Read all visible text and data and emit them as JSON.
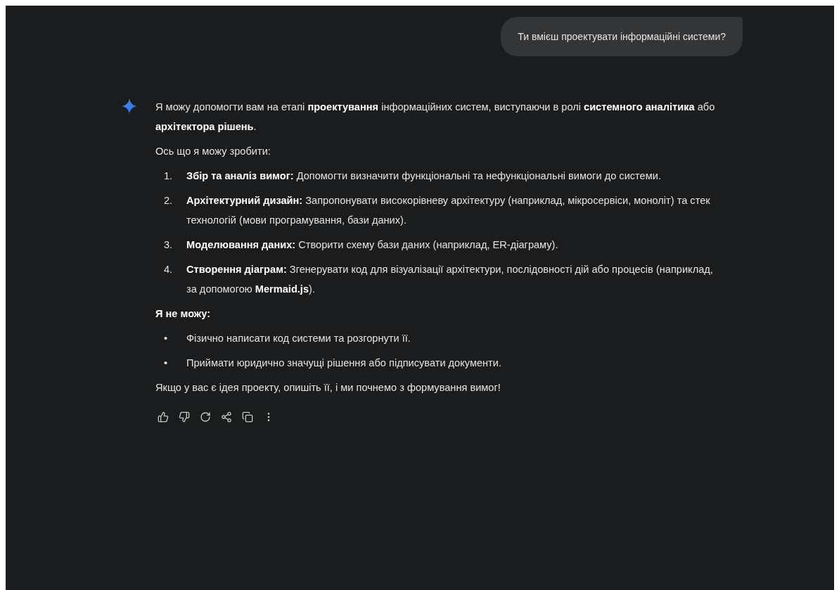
{
  "user_message": {
    "text": "Ти вмієш проектувати інформаційні системи?"
  },
  "response": {
    "intro": "Я можу допомогти вам на етапі **проектування** інформаційних систем, виступаючи в ролі **системного аналітика** або **архітектора рішень**.",
    "lead": "Ось що я можу зробити:",
    "numbered_list": [
      {
        "marker": "1.",
        "text": "**Збір та аналіз вимог:** Допомогти визначити функціональні та нефункціональні вимоги до системи."
      },
      {
        "marker": "2.",
        "text": "**Архітектурний дизайн:** Запропонувати високорівневу архітектуру (наприклад, мікросервіси, моноліт) та стек технологій (мови програмування, бази даних)."
      },
      {
        "marker": "3.",
        "text": "**Моделювання даних:** Створити схему бази даних (наприклад, ER-діаграму)."
      },
      {
        "marker": "4.",
        "text": "**Створення діаграм:** Згенерувати код для візуалізації архітектури, послідовності дій або процесів (наприклад, за допомогою **Mermaid.js**)."
      }
    ],
    "cannot_heading": "Я не можу:",
    "bullet_list": [
      {
        "marker": "•",
        "text": "Фізично написати код системи та розгорнути її."
      },
      {
        "marker": "•",
        "text": "Приймати юридично значущі рішення або підписувати документи."
      }
    ],
    "closing": "Якщо у вас є ідея проекту, опишіть її, і ми почнемо з формування вимог!"
  },
  "actions": [
    {
      "kind": "like"
    },
    {
      "kind": "dislike"
    },
    {
      "kind": "regenerate"
    },
    {
      "kind": "share"
    },
    {
      "kind": "copy"
    },
    {
      "kind": "more"
    }
  ]
}
